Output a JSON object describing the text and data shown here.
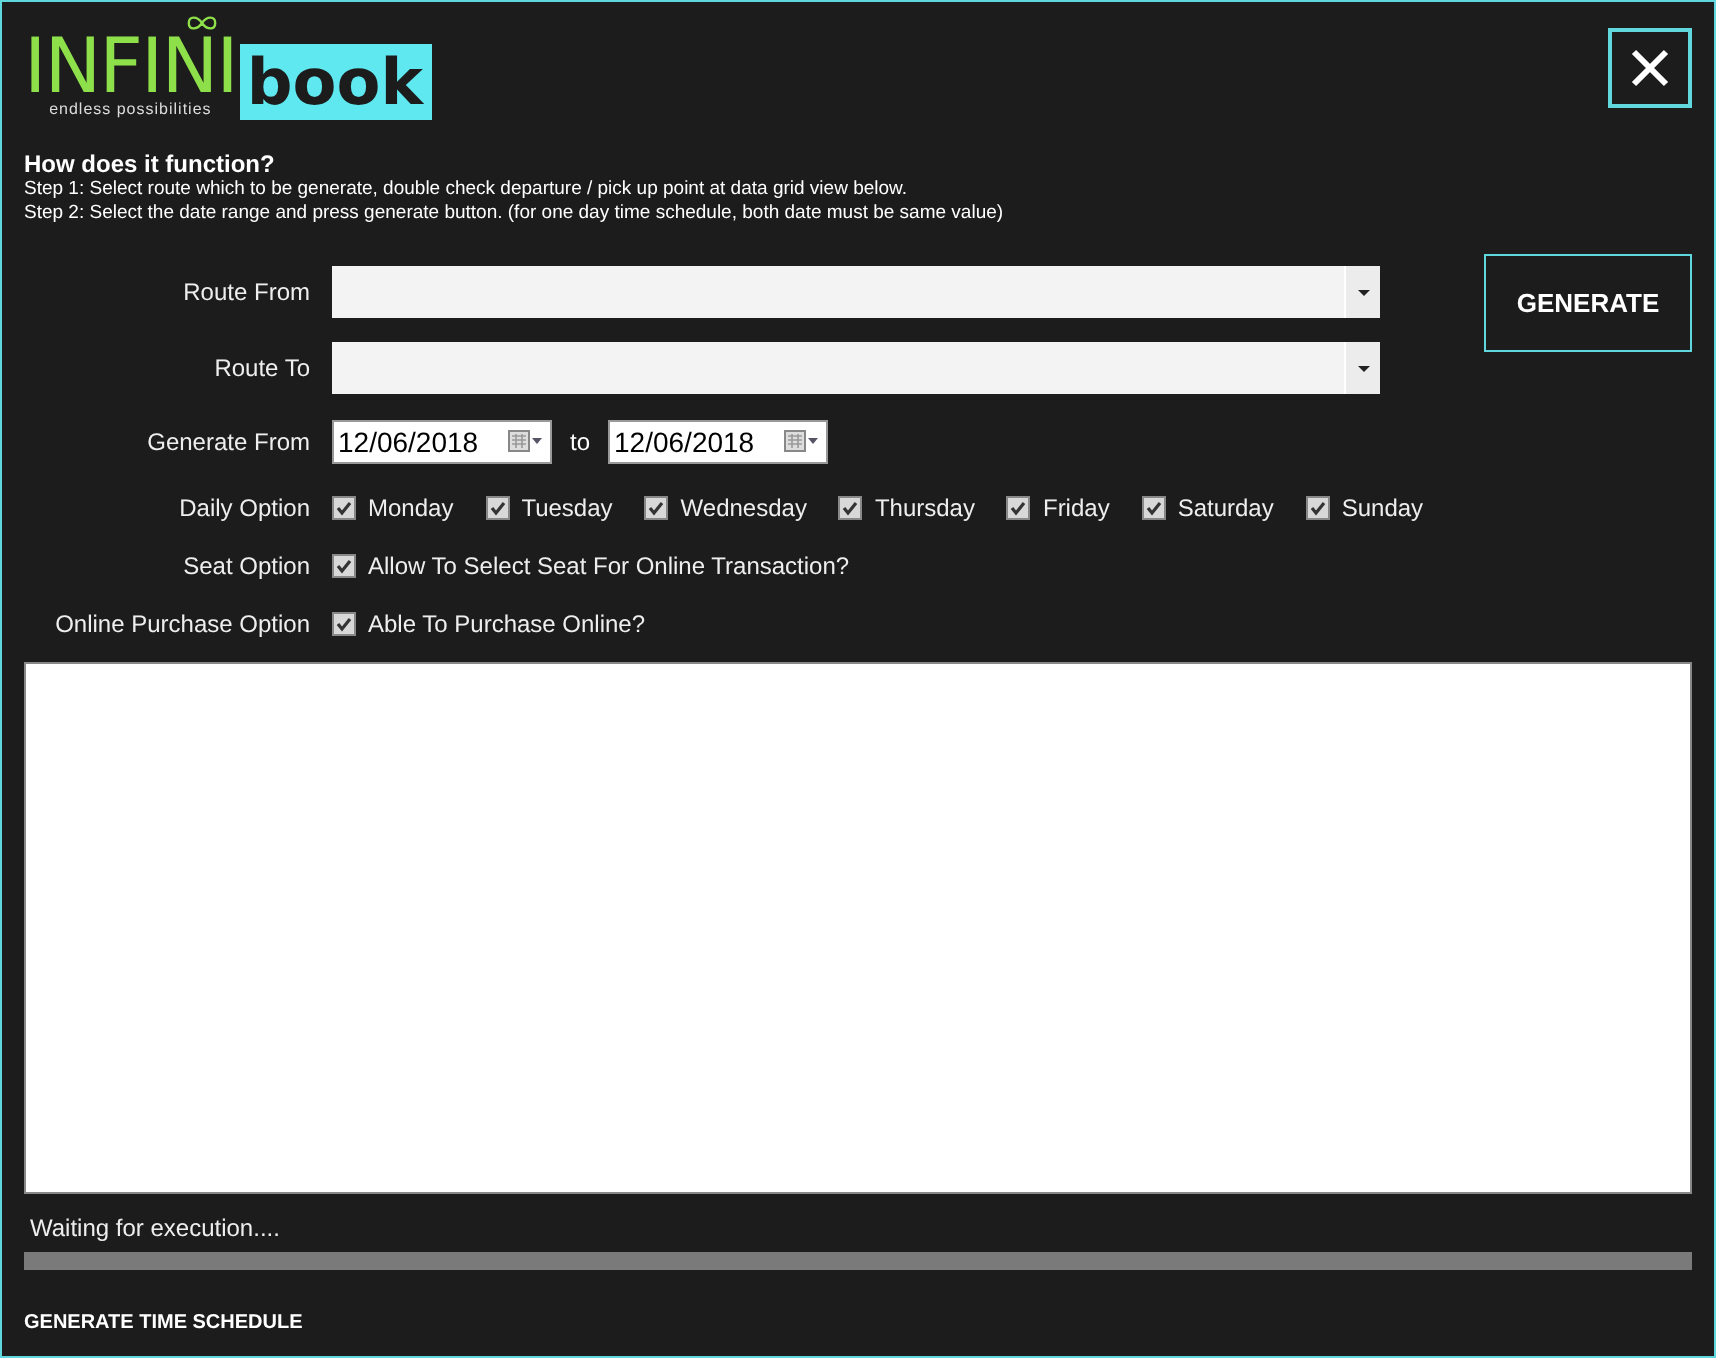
{
  "logo": {
    "brand_main": "INFINI",
    "brand_box": "book",
    "tagline": "endless possibilities"
  },
  "help": {
    "title": "How does it function?",
    "steps": [
      "Step 1: Select route which to be generate, double check departure / pick up point at data grid view below.",
      "Step 2: Select the date range and press generate button. (for one day time schedule, both date must be same value)"
    ]
  },
  "route_from": {
    "label": "Route From"
  },
  "route_to": {
    "label": "Route To"
  },
  "generate_button": "GENERATE",
  "date_range": {
    "label": "Generate From",
    "from": "12/06/2018",
    "separator": "to",
    "to": "12/06/2018"
  },
  "daily_option": {
    "label": "Daily Option",
    "days": [
      {
        "label": "Monday",
        "checked": true
      },
      {
        "label": "Tuesday",
        "checked": true
      },
      {
        "label": "Wednesday",
        "checked": true
      },
      {
        "label": "Thursday",
        "checked": true
      },
      {
        "label": "Friday",
        "checked": true
      },
      {
        "label": "Saturday",
        "checked": true
      },
      {
        "label": "Sunday",
        "checked": true
      }
    ]
  },
  "seat_option": {
    "label": "Seat Option",
    "text": "Allow To Select Seat For Online Transaction?",
    "checked": true
  },
  "online_purchase_option": {
    "label": "Online Purchase Option",
    "text": "Able To Purchase Online?",
    "checked": true
  },
  "status": {
    "text": "Waiting for execution....",
    "level": 0
  },
  "footer_title": "GENERATE TIME SCHEDULE"
}
